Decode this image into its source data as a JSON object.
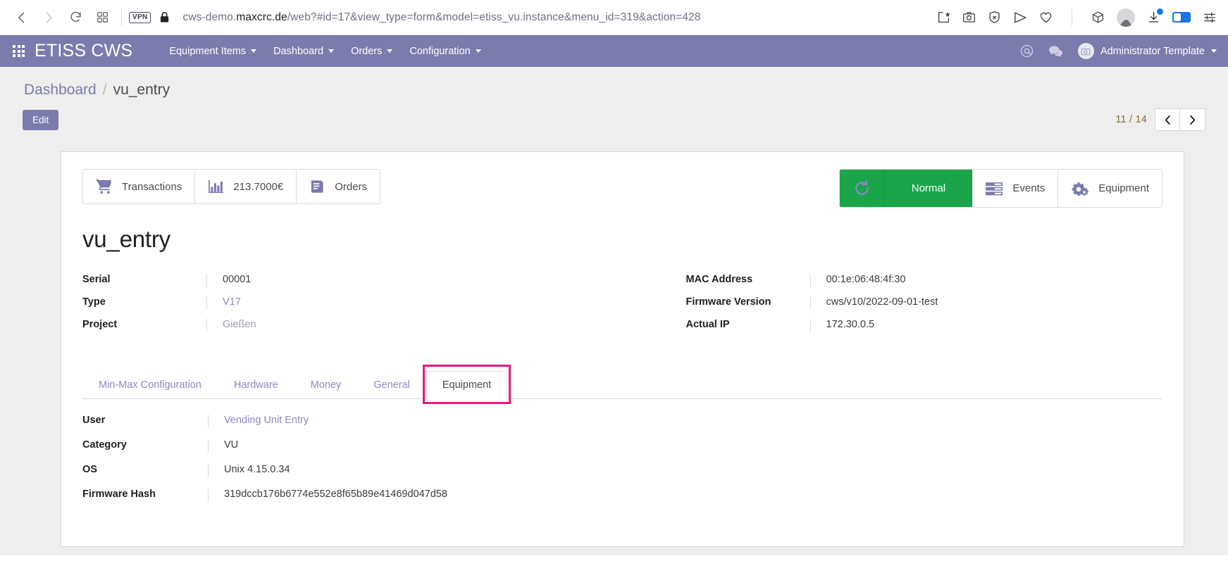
{
  "browser": {
    "back_icon": "chevron-left-icon",
    "forward_icon": "chevron-right-icon",
    "reload_icon": "reload-icon",
    "tabs_icon": "grid-tabs-icon",
    "vpn_badge": "VPN",
    "lock_icon": "lock-icon",
    "url_prefix": "cws-demo.",
    "url_host_strong": "maxcrc.de",
    "url_suffix": "/web?#id=17&view_type=form&model=etiss_vu.instance&menu_id=319&action=428",
    "extension_icons": [
      "bookmark-star-icon",
      "camera-icon",
      "shield-x-icon",
      "send-icon",
      "heart-icon",
      "cube-icon",
      "profile-avatar-icon",
      "download-icon",
      "battery-icon",
      "settings-sliders-icon"
    ]
  },
  "app_nav": {
    "apps_menu_icon": "apps-grid-icon",
    "brand": "ETISS CWS",
    "menu_items": [
      {
        "label": "Equipment Items",
        "has_caret": true
      },
      {
        "label": "Dashboard",
        "has_caret": true
      },
      {
        "label": "Orders",
        "has_caret": true
      },
      {
        "label": "Configuration",
        "has_caret": true
      }
    ],
    "right_icons": [
      "at-mention-icon",
      "chat-bubble-icon"
    ],
    "user_name": "Administrator Template",
    "user_avatar_icon": "user-avatar-icon"
  },
  "control_panel": {
    "breadcrumb": {
      "root": "Dashboard",
      "separator": "/",
      "current": "vu_entry"
    },
    "edit_label": "Edit",
    "pager": {
      "count": "11 / 14",
      "prev_icon": "chevron-left-icon",
      "next_icon": "chevron-right-icon"
    }
  },
  "sheet": {
    "stat_buttons_left": [
      {
        "icon": "shopping-cart-icon",
        "label": "Transactions"
      },
      {
        "icon": "bar-chart-icon",
        "label": "213.7000€"
      },
      {
        "icon": "book-orders-icon",
        "label": "Orders"
      }
    ],
    "stat_buttons_right": [
      {
        "icon": "refresh-circular-icon",
        "label": "",
        "style": "green-icon"
      },
      {
        "icon": "",
        "label": "Normal",
        "style": "green-label"
      },
      {
        "icon": "events-list-icon",
        "label": "Events",
        "style": "plain"
      },
      {
        "icon": "gears-icon",
        "label": "Equipment",
        "style": "plain"
      }
    ],
    "status_color": "#1aa54b",
    "accent_color": "#7c7bad",
    "title": "vu_entry",
    "fields_left": [
      {
        "label": "Serial",
        "value": "00001",
        "style": "plain"
      },
      {
        "label": "Type",
        "value": "V17",
        "style": "link"
      },
      {
        "label": "Project",
        "value": "Gießen",
        "style": "muted"
      }
    ],
    "fields_right": [
      {
        "label": "MAC Address",
        "value": "00:1e:06:48:4f:30",
        "style": "plain"
      },
      {
        "label": "Firmware Version",
        "value": "cws/v10/2022-09-01-test",
        "style": "plain"
      },
      {
        "label": "Actual IP",
        "value": "172.30.0.5",
        "style": "plain"
      }
    ],
    "tabs": [
      {
        "label": "Min-Max Configuration",
        "active": false,
        "highlighted": false
      },
      {
        "label": "Hardware",
        "active": false,
        "highlighted": false
      },
      {
        "label": "Money",
        "active": false,
        "highlighted": false
      },
      {
        "label": "General",
        "active": false,
        "highlighted": false
      },
      {
        "label": "Equipment",
        "active": true,
        "highlighted": true
      }
    ],
    "highlight_color": "#e8197d",
    "tab_fields": [
      {
        "label": "User",
        "value": "Vending Unit Entry",
        "style": "link"
      },
      {
        "label": "Category",
        "value": "VU",
        "style": "plain"
      },
      {
        "label": "OS",
        "value": "Unix 4.15.0.34",
        "style": "plain"
      },
      {
        "label": "Firmware Hash",
        "value": "319dccb176b6774e552e8f65b89e41469d047d58",
        "style": "plain"
      }
    ]
  }
}
